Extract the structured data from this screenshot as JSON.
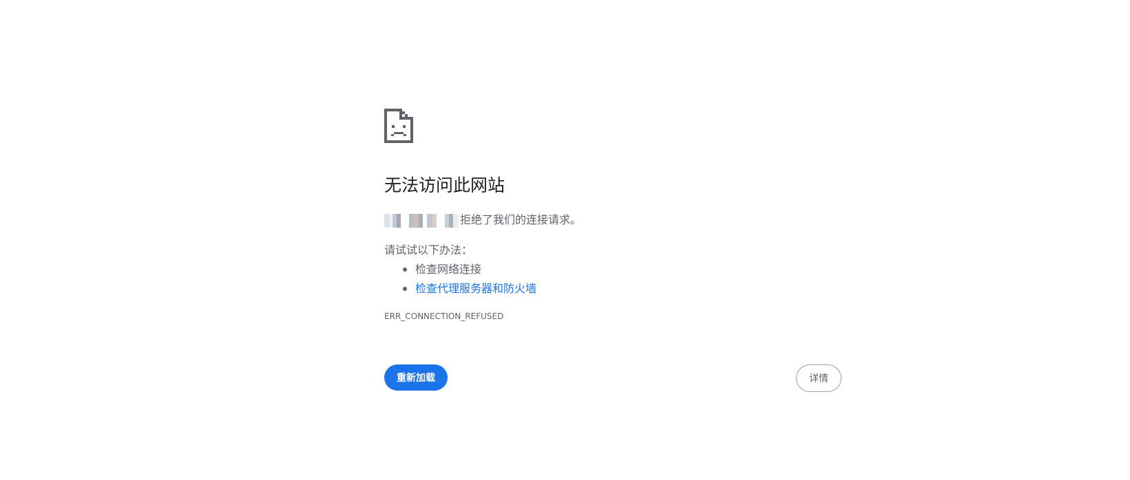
{
  "page": {
    "heading": "无法访问此网站",
    "summary_text": "拒绝了我们的连接请求。",
    "suggestions_title": "请试试以下办法：",
    "suggestions": [
      {
        "label": "检查网络连接",
        "is_link": false
      },
      {
        "label": "检查代理服务器和防火墙",
        "is_link": true
      }
    ],
    "error_code": "ERR_CONNECTION_REFUSED"
  },
  "buttons": {
    "reload_label": "重新加载",
    "details_label": "详情"
  },
  "colors": {
    "accent": "#1a73e8",
    "heading": "#202124",
    "text": "#5f6368",
    "background": "#ffffff"
  },
  "icons": {
    "error": "sad-document-icon"
  }
}
